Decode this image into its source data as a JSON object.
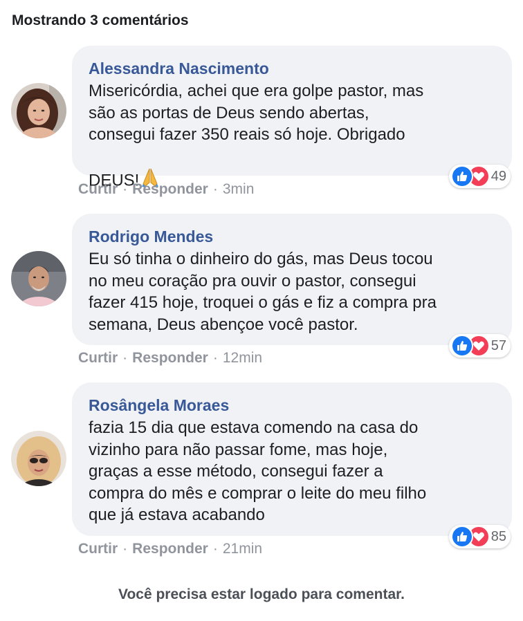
{
  "header": {
    "title": "Mostrando 3 comentários"
  },
  "comments": [
    {
      "author": "Alessandra Nascimento",
      "text": "Misericórdia, achei que era golpe pastor, mas\nsão as portas de Deus sendo abertas,\nconsegui fazer 350 reais só hoje. Obrigado\nDEUS!",
      "emoji": "🙏",
      "reaction_count": "49",
      "like_label": "Curtir",
      "reply_label": "Responder",
      "time": "3min",
      "avatar_bg": "#6b4a3c"
    },
    {
      "author": "Rodrigo Mendes",
      "text": "Eu só tinha o dinheiro do gás, mas Deus tocou\nno meu coração pra ouvir o pastor, consegui\nfazer 415 hoje, troquei o gás e fiz a compra pra\nsemana, Deus abençoe você pastor.",
      "emoji": "",
      "reaction_count": "57",
      "like_label": "Curtir",
      "reply_label": "Responder",
      "time": "12min",
      "avatar_bg": "#8b8f94"
    },
    {
      "author": "Rosângela Moraes",
      "text": "fazia 15 dia que estava comendo na casa do\nvizinho para não passar fome, mas hoje,\ngraças a esse método, consegui fazer a\ncompra do mês e comprar o leite do meu filho\nque já estava acabando",
      "emoji": "",
      "reaction_count": "85",
      "like_label": "Curtir",
      "reply_label": "Responder",
      "time": "21min",
      "avatar_bg": "#c9a27a"
    }
  ],
  "footer": {
    "text": "Você precisa estar logado para comentar."
  },
  "colors": {
    "author": "#385898",
    "bubble": "#f0f2f5",
    "like": "#1877f2",
    "love": "#f33e58",
    "meta": "#90949c"
  },
  "icons": [
    "like-icon",
    "love-icon",
    "praying-hands-icon"
  ]
}
